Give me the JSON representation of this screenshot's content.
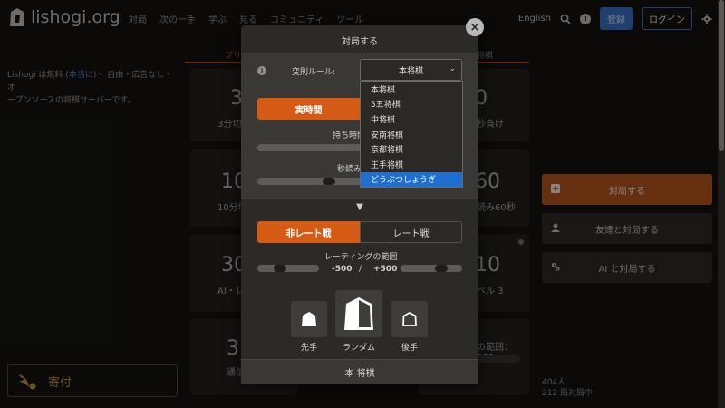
{
  "brand": {
    "name": "lishogi.org"
  },
  "nav": {
    "links": [
      "対局",
      "次の一手",
      "学ぶ",
      "見る",
      "コミュニティ",
      "ツール"
    ],
    "language": "English",
    "register": "登録",
    "login": "ログイン"
  },
  "intro": {
    "line1_pre": "Lishogi は無料 (",
    "line1_link": "本当に",
    "line1_post": ")・ 自由・広告なし・オ",
    "line2": "ープンソースの将棋サーバーです。"
  },
  "donate": {
    "label": "寄付"
  },
  "lobby": {
    "tab_left": "プリ",
    "tab_right": "将棋",
    "pools": [
      {
        "big": "3",
        "small": "3分切"
      },
      {
        "big": "0",
        "small": "秒負け"
      },
      {
        "big": "10",
        "small": "10分切"
      },
      {
        "big": "60",
        "small": "読み60秒"
      },
      {
        "big": "30",
        "small": "AI・レ"
      },
      {
        "big": "10",
        "small": "ベル 3"
      },
      {
        "big": "3",
        "small": "通信"
      },
      {
        "big": "",
        "small": "の範囲：250"
      }
    ]
  },
  "right_panel": {
    "create_game": "対局する",
    "play_friend": "友達と対局する",
    "play_ai": "AI と対局する",
    "players": "404人",
    "games": "212 局対局中"
  },
  "modal": {
    "title": "対局する",
    "variant_label": "変則ルール:",
    "variant_selected": "本将棋",
    "time_mode": {
      "active": "実時間",
      "inactive": ""
    },
    "time_label": "持ち時間",
    "byoyomi_label": "秒読み",
    "rated": {
      "casual": "非レート戦",
      "rated": "レート戦"
    },
    "rating_range_label": "レーティングの範囲",
    "rating_min": "-500",
    "rating_sep": "/",
    "rating_max": "+500",
    "sides": {
      "sente": "先手",
      "random": "ランダム",
      "gote": "後手"
    },
    "footer": "本 将棋"
  },
  "dropdown": {
    "options": [
      "本将棋",
      "5五将棋",
      "中将棋",
      "安南将棋",
      "京都将棋",
      "王手将棋",
      "どうぶつしょうぎ"
    ],
    "highlighted": "どうぶつしょうぎ"
  },
  "colors": {
    "accent_orange": "#d55b14",
    "link_blue": "#3b7ad6",
    "highlight_blue": "#1f6fd1",
    "gold": "#c8a046"
  }
}
